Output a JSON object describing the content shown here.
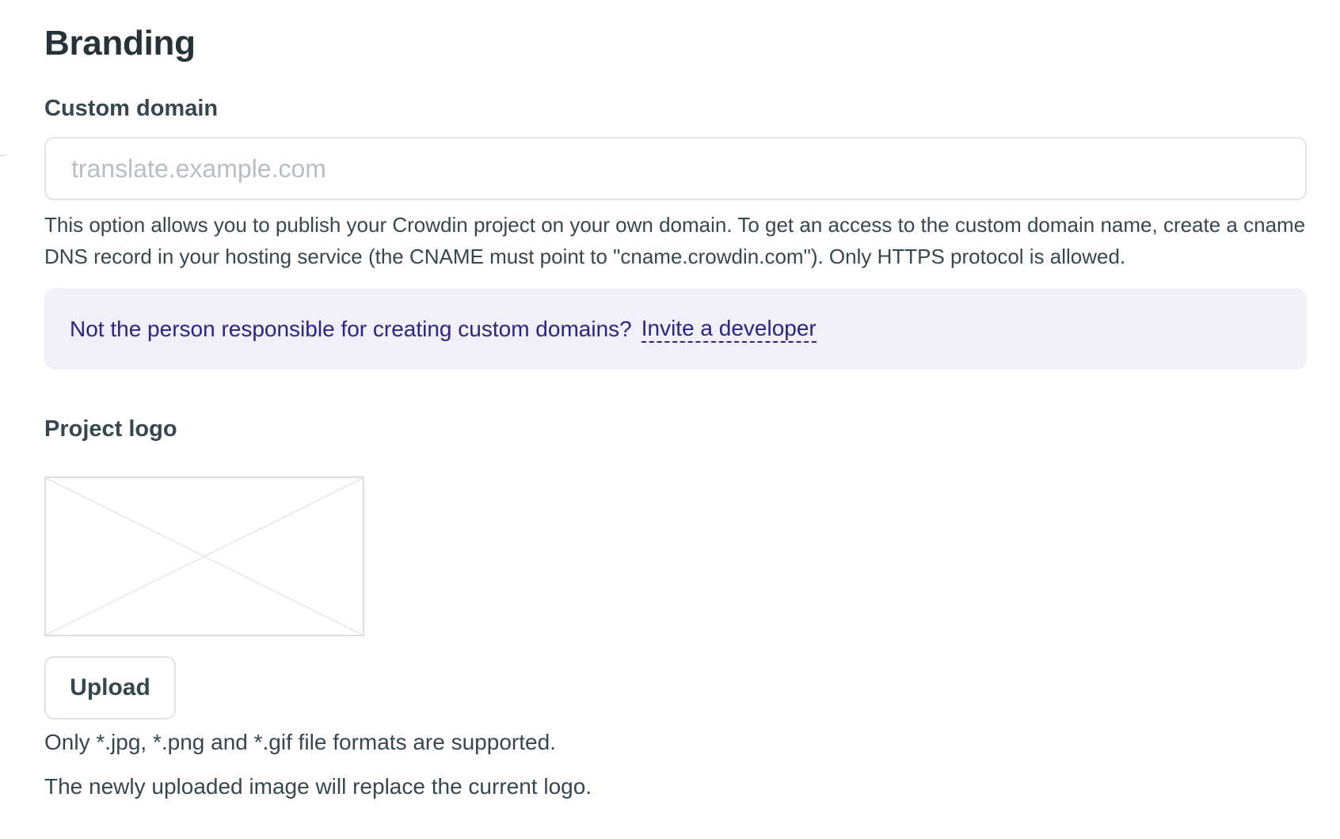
{
  "page": {
    "title": "Branding"
  },
  "custom_domain": {
    "label": "Custom domain",
    "value": "",
    "placeholder": "translate.example.com",
    "help": "This option allows you to publish your Crowdin project on your own domain. To get an access to the custom domain name, create a cname DNS record in your hosting service (the CNAME must point to \"cname.crowdin.com\"). Only HTTPS protocol is allowed."
  },
  "info_box": {
    "text": "Not the person responsible for creating custom domains?",
    "link_label": "Invite a developer"
  },
  "project_logo": {
    "label": "Project logo",
    "upload_label": "Upload",
    "formats_note": "Only *.jpg, *.png and *.gif file formats are supported.",
    "replace_note": "The newly uploaded image will replace the current logo."
  },
  "colors": {
    "text": "#263238",
    "info_background": "#f1f0fa",
    "info_text": "#2c2483",
    "border": "#e3e6e8"
  }
}
